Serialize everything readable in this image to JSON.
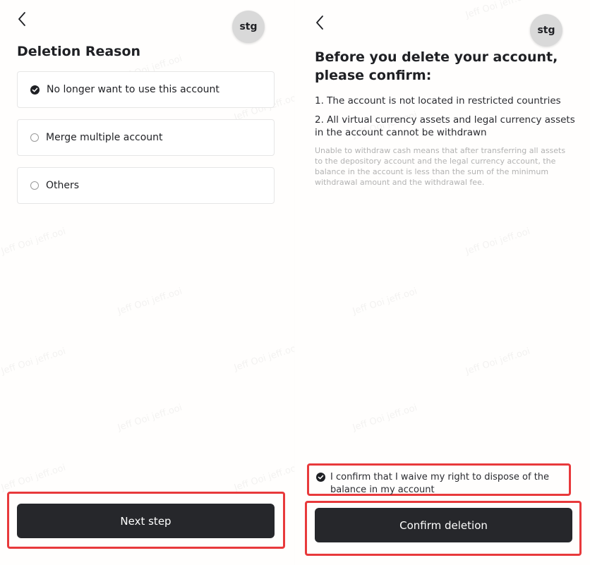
{
  "watermark_text": "Jeff Ooi jeff.ooi",
  "accent_colors": {
    "button": "#26272b",
    "highlight": "#e8393b",
    "avatar_bg": "#d9d9d9"
  },
  "left_screen": {
    "back_icon": "chevron-left-icon",
    "avatar_text": "stg",
    "title": "Deletion Reason",
    "options": [
      {
        "label": "No longer want to use this account",
        "selected": true
      },
      {
        "label": "Merge multiple account",
        "selected": false
      },
      {
        "label": "Others",
        "selected": false
      }
    ],
    "next_button_label": "Next step"
  },
  "right_screen": {
    "back_icon": "chevron-left-icon",
    "avatar_text": "stg",
    "title_line1": "Before you delete your account,",
    "title_line2": "please confirm:",
    "points": [
      "1. The account is not located in restricted countries",
      "2. All virtual currency assets and legal currency assets in the account cannot be withdrawn"
    ],
    "note": "Unable to withdraw cash means that after transferring all assets to the depository account and the legal currency account, the balance in the account is less than the sum of the minimum withdrawal amount and the withdrawal fee.",
    "confirm_checkbox_label": "I confirm that I waive my right to dispose of the balance in my account",
    "confirm_checked": true,
    "confirm_button_label": "Confirm deletion"
  }
}
